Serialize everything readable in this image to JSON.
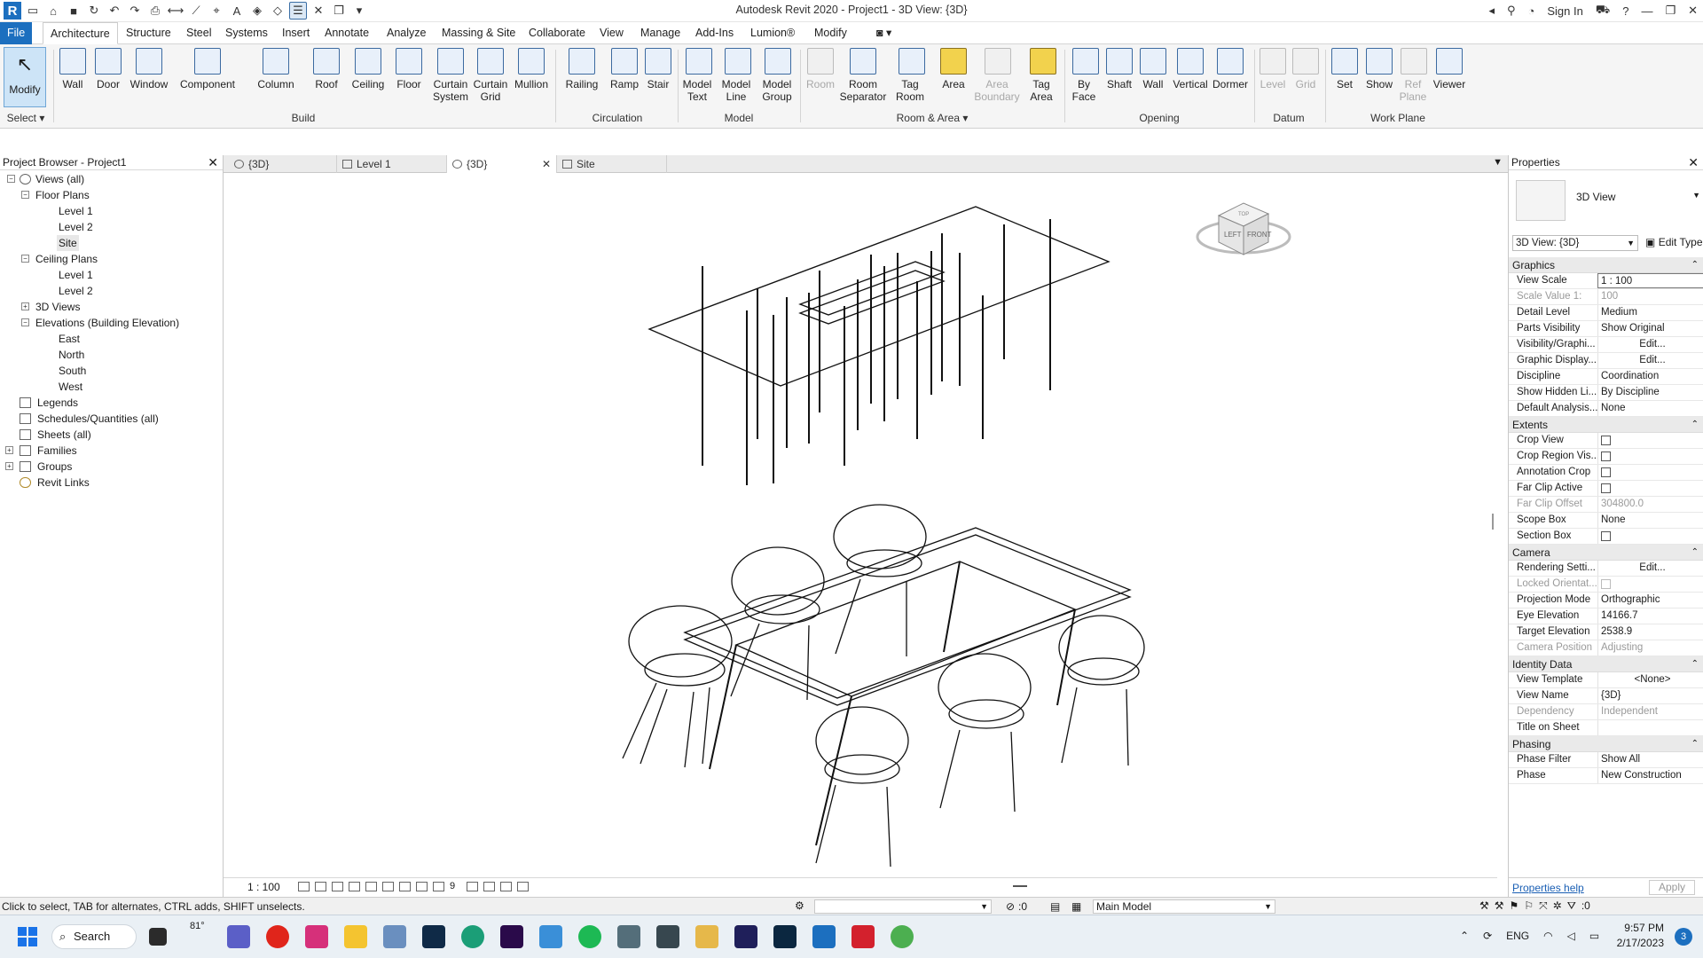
{
  "window": {
    "title": "Autodesk Revit 2020 - Project1 - 3D View: {3D}",
    "sign_in": "Sign In"
  },
  "menu": {
    "tabs": [
      "File",
      "Architecture",
      "Structure",
      "Steel",
      "Systems",
      "Insert",
      "Annotate",
      "Analyze",
      "Massing & Site",
      "Collaborate",
      "View",
      "Manage",
      "Add-Ins",
      "Lumion®",
      "Modify"
    ]
  },
  "ribbon": {
    "select_label": "Select",
    "modify": "Modify",
    "buttons": [
      {
        "label": "Wall"
      },
      {
        "label": "Door"
      },
      {
        "label": "Window"
      },
      {
        "label": "Component"
      },
      {
        "label": "Column"
      },
      {
        "label": "Roof"
      },
      {
        "label": "Ceiling"
      },
      {
        "label": "Floor"
      },
      {
        "label": "Curtain System"
      },
      {
        "label": "Curtain Grid"
      },
      {
        "label": "Mullion"
      },
      {
        "label": "Railing"
      },
      {
        "label": "Ramp"
      },
      {
        "label": "Stair"
      },
      {
        "label": "Model Text"
      },
      {
        "label": "Model Line"
      },
      {
        "label": "Model Group"
      },
      {
        "label": "Room"
      },
      {
        "label": "Room Separator"
      },
      {
        "label": "Tag Room"
      },
      {
        "label": "Area"
      },
      {
        "label": "Area Boundary"
      },
      {
        "label": "Tag Area"
      },
      {
        "label": "By Face"
      },
      {
        "label": "Shaft"
      },
      {
        "label": "Wall"
      },
      {
        "label": "Vertical"
      },
      {
        "label": "Dormer"
      },
      {
        "label": "Level"
      },
      {
        "label": "Grid"
      },
      {
        "label": "Set"
      },
      {
        "label": "Show"
      },
      {
        "label": "Ref Plane"
      },
      {
        "label": "Viewer"
      }
    ],
    "groups": [
      "Build",
      "Circulation",
      "Model",
      "Room & Area",
      "Opening",
      "Datum",
      "Work Plane"
    ]
  },
  "project_browser": {
    "title": "Project Browser - Project1",
    "items": [
      {
        "label": "Views (all)"
      },
      {
        "label": "Floor Plans"
      },
      {
        "label": "Level 1"
      },
      {
        "label": "Level 2"
      },
      {
        "label": "Site"
      },
      {
        "label": "Ceiling Plans"
      },
      {
        "label": "Level 1"
      },
      {
        "label": "Level 2"
      },
      {
        "label": "3D Views"
      },
      {
        "label": "Elevations (Building Elevation)"
      },
      {
        "label": "East"
      },
      {
        "label": "North"
      },
      {
        "label": "South"
      },
      {
        "label": "West"
      },
      {
        "label": "Legends"
      },
      {
        "label": "Schedules/Quantities (all)"
      },
      {
        "label": "Sheets (all)"
      },
      {
        "label": "Families"
      },
      {
        "label": "Groups"
      },
      {
        "label": "Revit Links"
      }
    ]
  },
  "view_tabs": [
    {
      "label": "{3D}"
    },
    {
      "label": "Level 1"
    },
    {
      "label": "{3D}"
    },
    {
      "label": "Site"
    }
  ],
  "viewcube": {
    "left": "LEFT",
    "front": "FRONT",
    "top": "TOP"
  },
  "view_bar": {
    "scale": "1 : 100",
    "count": "9"
  },
  "properties": {
    "title": "Properties",
    "type_name": "3D View",
    "selector": "3D View: {3D}",
    "edit_type": "Edit Type",
    "sections": [
      {
        "name": "Graphics",
        "rows": [
          {
            "k": "View Scale",
            "v": "1 : 100"
          },
          {
            "k": "Scale Value    1:",
            "v": "100"
          },
          {
            "k": "Detail Level",
            "v": "Medium"
          },
          {
            "k": "Parts Visibility",
            "v": "Show Original"
          },
          {
            "k": "Visibility/Graphi...",
            "v": "Edit..."
          },
          {
            "k": "Graphic Display...",
            "v": "Edit..."
          },
          {
            "k": "Discipline",
            "v": "Coordination"
          },
          {
            "k": "Show Hidden Li...",
            "v": "By Discipline"
          },
          {
            "k": "Default Analysis...",
            "v": "None"
          }
        ]
      },
      {
        "name": "Extents",
        "rows": [
          {
            "k": "Crop View",
            "v": ""
          },
          {
            "k": "Crop Region Vis...",
            "v": ""
          },
          {
            "k": "Annotation Crop",
            "v": ""
          },
          {
            "k": "Far Clip Active",
            "v": ""
          },
          {
            "k": "Far Clip Offset",
            "v": "304800.0"
          },
          {
            "k": "Scope Box",
            "v": "None"
          },
          {
            "k": "Section Box",
            "v": ""
          }
        ]
      },
      {
        "name": "Camera",
        "rows": [
          {
            "k": "Rendering Setti...",
            "v": "Edit..."
          },
          {
            "k": "Locked Orientat...",
            "v": ""
          },
          {
            "k": "Projection Mode",
            "v": "Orthographic"
          },
          {
            "k": "Eye Elevation",
            "v": "14166.7"
          },
          {
            "k": "Target Elevation",
            "v": "2538.9"
          },
          {
            "k": "Camera Position",
            "v": "Adjusting"
          }
        ]
      },
      {
        "name": "Identity Data",
        "rows": [
          {
            "k": "View Template",
            "v": "<None>"
          },
          {
            "k": "View Name",
            "v": "{3D}"
          },
          {
            "k": "Dependency",
            "v": "Independent"
          },
          {
            "k": "Title on Sheet",
            "v": ""
          }
        ]
      },
      {
        "name": "Phasing",
        "rows": [
          {
            "k": "Phase Filter",
            "v": "Show All"
          },
          {
            "k": "Phase",
            "v": "New Construction"
          }
        ]
      }
    ],
    "help": "Properties help",
    "apply": "Apply"
  },
  "status": {
    "message": "Click to select, TAB for alternates, CTRL adds, SHIFT unselects.",
    "select_count": ":0",
    "model": "Main Model",
    "filter_count": ":0"
  },
  "taskbar": {
    "search": "Search",
    "weather": "81°",
    "lang": "ENG",
    "time": "9:57 PM",
    "date": "2/17/2023",
    "badge": "3"
  }
}
